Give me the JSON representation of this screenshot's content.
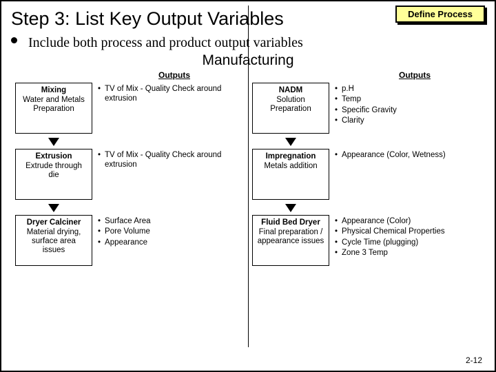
{
  "badge": "Define Process",
  "title": "Step 3:  List Key Output Variables",
  "subtitle": "Include both process and product output variables",
  "manufacturing": "Manufacturing",
  "outputs_label": "Outputs",
  "page_number": "2-12",
  "left": {
    "b1": {
      "title": "Mixing",
      "desc": "Water and Metals Preparation"
    },
    "o1": [
      "TV of Mix - Quality Check around extrusion"
    ],
    "b2": {
      "title": "Extrusion",
      "desc": "Extrude through die"
    },
    "o2": [
      "TV of Mix - Quality Check around extrusion"
    ],
    "b3": {
      "title": "Dryer Calciner",
      "desc": "Material drying, surface area issues"
    },
    "o3": [
      "Surface Area",
      "Pore Volume",
      "Appearance"
    ]
  },
  "right": {
    "b1": {
      "title": "NADM",
      "desc": "Solution Preparation"
    },
    "o1": [
      "p.H",
      "Temp",
      "Specific Gravity",
      "Clarity"
    ],
    "b2": {
      "title": "Impregnation",
      "desc": "Metals addition"
    },
    "o2": [
      "Appearance (Color, Wetness)"
    ],
    "b3": {
      "title": "Fluid Bed Dryer",
      "desc": "Final preparation / appearance issues"
    },
    "o3": [
      "Appearance (Color)",
      "Physical Chemical Properties",
      "Cycle Time (plugging)",
      "Zone 3 Temp"
    ]
  }
}
